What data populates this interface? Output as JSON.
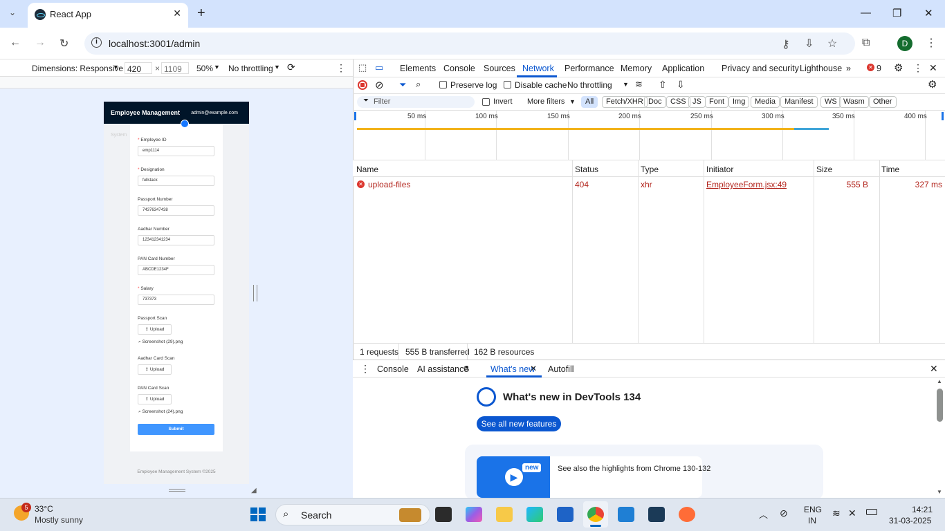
{
  "browser": {
    "tab_title": "React App",
    "new_tab": "+",
    "url": "localhost:3001/admin",
    "avatar_letter": "D"
  },
  "device_toolbar": {
    "dimensions_label": "Dimensions: Responsive",
    "width": "420",
    "times": "×",
    "height": "1109",
    "zoom": "50%",
    "throttling": "No throttling"
  },
  "app": {
    "title": "Employee Management",
    "user_email": "admin@example.com",
    "side_text": "System",
    "fields": [
      {
        "label": "Employee ID",
        "required": true,
        "value": "emp1114"
      },
      {
        "label": "Designation",
        "required": true,
        "value": "fullstack"
      },
      {
        "label": "Passport Number",
        "required": false,
        "value": "74376347438"
      },
      {
        "label": "Aadhar Number",
        "required": false,
        "value": "123412341234"
      },
      {
        "label": "PAN Card Number",
        "required": false,
        "value": "ABCDE1234F"
      },
      {
        "label": "Salary",
        "required": true,
        "value": "737373"
      }
    ],
    "uploads": [
      {
        "label": "Passport Scan",
        "button": "Upload",
        "file": "Screenshot (29).png"
      },
      {
        "label": "Aadhar Card Scan",
        "button": "Upload",
        "file": ""
      },
      {
        "label": "PAN Card Scan",
        "button": "Upload",
        "file": "Screenshot (24).png"
      }
    ],
    "required_mark": "*",
    "submit": "Submit",
    "footer": "Employee Management System ©2025"
  },
  "devtools": {
    "tabs": [
      "Elements",
      "Console",
      "Sources",
      "Network",
      "Performance",
      "Memory",
      "Application",
      "Privacy and security",
      "Lighthouse"
    ],
    "active_tab": "Network",
    "more_tabs": "»",
    "error_count": "9",
    "network_toolbar": {
      "preserve_log": "Preserve log",
      "disable_cache": "Disable cache",
      "throttling": "No throttling"
    },
    "filter": {
      "placeholder": "Filter",
      "invert": "Invert",
      "more_filters": "More filters",
      "types": [
        "All",
        "Fetch/XHR",
        "Doc",
        "CSS",
        "JS",
        "Font",
        "Img",
        "Media",
        "Manifest",
        "WS",
        "Wasm",
        "Other"
      ]
    },
    "timeline_ticks": [
      "50 ms",
      "100 ms",
      "150 ms",
      "200 ms",
      "250 ms",
      "300 ms",
      "350 ms",
      "400 ms"
    ],
    "columns": [
      "Name",
      "Status",
      "Type",
      "Initiator",
      "Size",
      "Time"
    ],
    "rows": [
      {
        "name": "upload-files",
        "status": "404",
        "type": "xhr",
        "initiator": "EmployeeForm.jsx:49",
        "size": "555 B",
        "time": "327 ms"
      }
    ],
    "status_bar": {
      "requests": "1 requests",
      "transferred": "555 B transferred",
      "resources": "162 B resources"
    },
    "drawer": {
      "tabs": [
        "Console",
        "AI assistance",
        "What's new",
        "Autofill"
      ],
      "active_tab": "What's new",
      "heading": "What's new in DevTools 134",
      "see_all": "See all new features",
      "badge": "new",
      "highlight_text": "See also the highlights from Chrome 130-132"
    }
  },
  "taskbar": {
    "weather_badge": "5",
    "temperature": "33°C",
    "condition": "Mostly sunny",
    "search": "Search",
    "lang1": "ENG",
    "lang2": "IN",
    "time": "14:21",
    "date": "31-03-2025"
  },
  "colors": {
    "tab_strip": "#d3e3fd",
    "app_header": "#001529",
    "submit": "#4096ff",
    "error": "#b3261e",
    "accent": "#0b57d0"
  }
}
